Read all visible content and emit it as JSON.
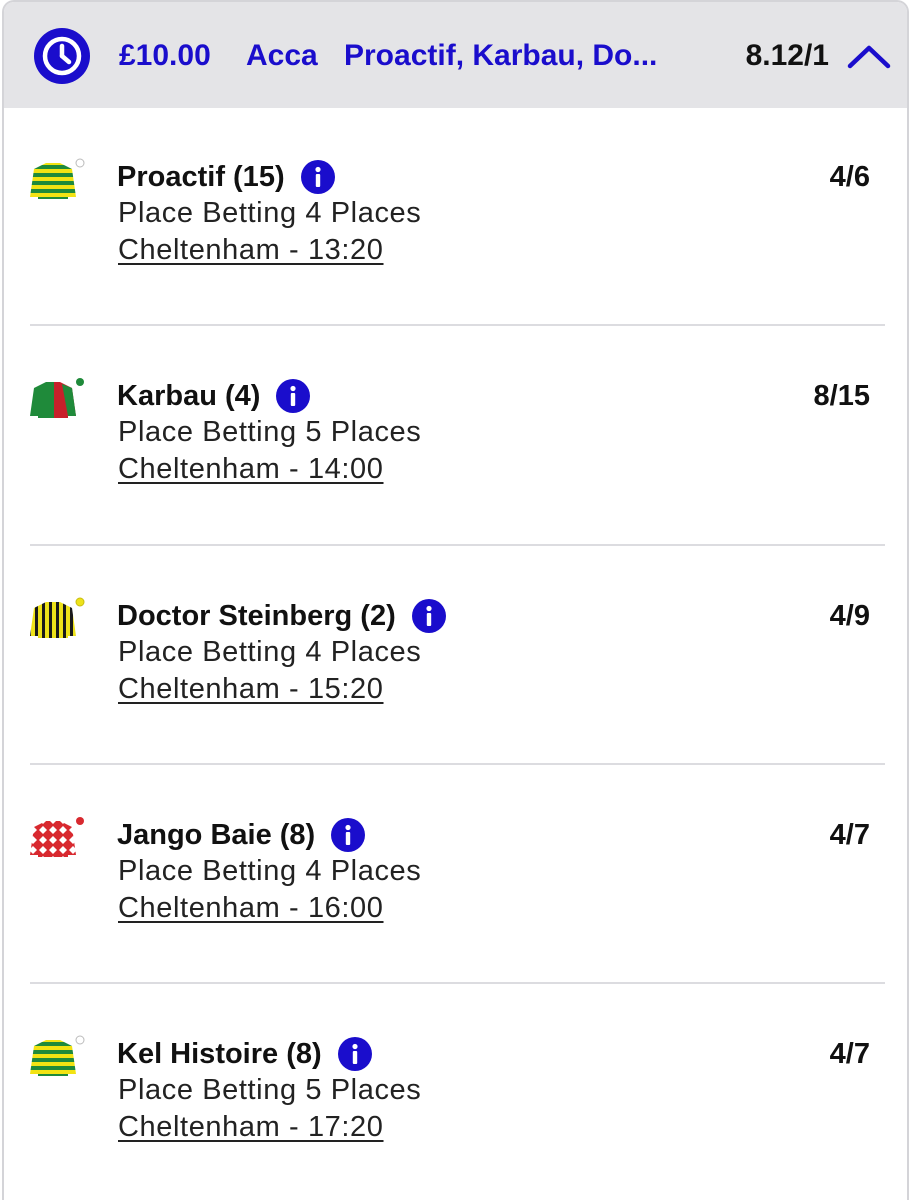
{
  "header": {
    "stake": "£10.00",
    "bet_type": "Acca",
    "selections_summary": "Proactif, Karbau, Do...",
    "total_odds": "8.12/1",
    "clock_icon": "clock-icon",
    "collapse_icon": "chevron-up-icon"
  },
  "colors": {
    "accent": "#1a0dcc",
    "header_bg": "#e4e4e7",
    "divider": "#dcdce0"
  },
  "legs": [
    {
      "runner": "Proactif (15)",
      "market": "Place Betting 4 Places",
      "event": "Cheltenham - 13:20",
      "price": "4/6",
      "silk": "green-yellow-hooped-silk-icon"
    },
    {
      "runner": "Karbau (4)",
      "market": "Place Betting 5 Places",
      "event": "Cheltenham - 14:00",
      "price": "8/15",
      "silk": "green-red-halved-silk-icon"
    },
    {
      "runner": "Doctor Steinberg (2)",
      "market": "Place Betting 4 Places",
      "event": "Cheltenham - 15:20",
      "price": "4/9",
      "silk": "yellow-black-striped-silk-icon"
    },
    {
      "runner": "Jango Baie (8)",
      "market": "Place Betting 4 Places",
      "event": "Cheltenham - 16:00",
      "price": "4/7",
      "silk": "red-white-diamond-silk-icon"
    },
    {
      "runner": "Kel Histoire (8)",
      "market": "Place Betting 5 Places",
      "event": "Cheltenham - 17:20",
      "price": "4/7",
      "silk": "green-yellow-hooped-silk-icon"
    }
  ]
}
